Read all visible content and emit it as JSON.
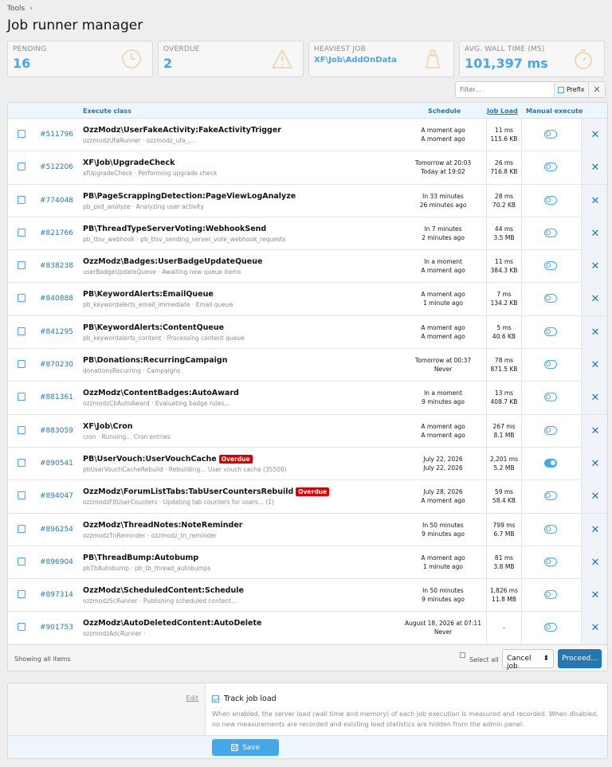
{
  "breadcrumb": {
    "tools": "Tools",
    "sep": "›"
  },
  "page_title": "Job runner manager",
  "stats": {
    "pending": {
      "label": "PENDING",
      "value": "16"
    },
    "overdue": {
      "label": "OVERDUE",
      "value": "2"
    },
    "heaviest": {
      "label": "HEAVIEST JOB",
      "value": "XF\\Job\\AddOnData"
    },
    "avgwall": {
      "label": "AVG. WALL TIME (MS)",
      "value": "101,397 ms"
    }
  },
  "filter": {
    "placeholder": "Filter...",
    "prefix": "Prefix",
    "clear": "✕"
  },
  "table": {
    "headers": {
      "execute_class": "Execute class",
      "schedule": "Schedule",
      "job_load": "Job Load",
      "manual": "Manual execute"
    },
    "rows": [
      {
        "id": "#511796",
        "cls": "OzzModz\\UserFakeActivity:FakeActivityTrigger",
        "badge": "",
        "desc": "ozzmodzUfaRunner · ozzmodz_ufa_...",
        "s1": "A moment ago",
        "s2": "A moment ago",
        "l1": "11 ms",
        "l2": "115.6 KB",
        "on": false
      },
      {
        "id": "#512206",
        "cls": "XF\\Job\\UpgradeCheck",
        "badge": "",
        "desc": "xfUpgradeCheck · Performing upgrade check",
        "s1": "Tomorrow at 20:03",
        "s2": "Today at 19:02",
        "l1": "26 ms",
        "l2": "716.8 KB",
        "on": false
      },
      {
        "id": "#774048",
        "cls": "PB\\PageScrappingDetection:PageViewLogAnalyze",
        "badge": "",
        "desc": "pb_psd_analyze · Analyzing user activity",
        "s1": "In 33 minutes",
        "s2": "26 minutes ago",
        "l1": "28 ms",
        "l2": "70.2 KB",
        "on": false
      },
      {
        "id": "#821766",
        "cls": "PB\\ThreadTypeServerVoting:WebhookSend",
        "badge": "",
        "desc": "pb_ttsv_webhook · pb_ttsv_sending_server_vote_webhook_requests",
        "s1": "In 7 minutes",
        "s2": "2 minutes ago",
        "l1": "44 ms",
        "l2": "3.5 MB",
        "on": false
      },
      {
        "id": "#838238",
        "cls": "OzzModz\\Badges:UserBadgeUpdateQueue",
        "badge": "",
        "desc": "userBadgeUpdateQueue · Awaiting new queue items",
        "s1": "In a moment",
        "s2": "A moment ago",
        "l1": "11 ms",
        "l2": "384.3 KB",
        "on": false
      },
      {
        "id": "#840888",
        "cls": "PB\\KeywordAlerts:EmailQueue",
        "badge": "",
        "desc": "pb_keywordalerts_email_immediate · Email queue",
        "s1": "A moment ago",
        "s2": "1 minute ago",
        "l1": "7 ms",
        "l2": "134.2 KB",
        "on": false
      },
      {
        "id": "#841295",
        "cls": "PB\\KeywordAlerts:ContentQueue",
        "badge": "",
        "desc": "pb_keywordalerts_content · Processing content queue",
        "s1": "A moment ago",
        "s2": "A moment ago",
        "l1": "5 ms",
        "l2": "40.6 KB",
        "on": false
      },
      {
        "id": "#870230",
        "cls": "PB\\Donations:RecurringCampaign",
        "badge": "",
        "desc": "donationsRecurring · Campaigns",
        "s1": "Tomorrow at 00:37",
        "s2": "Never",
        "l1": "78 ms",
        "l2": "871.5 KB",
        "on": false
      },
      {
        "id": "#881361",
        "cls": "OzzModz\\ContentBadges:AutoAward",
        "badge": "",
        "desc": "ozzmodzCbAutoAward · Evaluating badge rules...",
        "s1": "In a moment",
        "s2": "9 minutes ago",
        "l1": "13 ms",
        "l2": "408.7 KB",
        "on": false
      },
      {
        "id": "#883059",
        "cls": "XF\\Job\\Cron",
        "badge": "",
        "desc": "cron · Running... Cron entries",
        "s1": "A moment ago",
        "s2": "A moment ago",
        "l1": "267 ms",
        "l2": "8.1 MB",
        "on": false
      },
      {
        "id": "#890541",
        "cls": "PB\\UserVouch:UserVouchCache",
        "badge": "Overdue",
        "desc": "pbUserVouchCacheRebuild · Rebuilding... User vouch cache (35500)",
        "s1": "July 22, 2026",
        "s2": "July 22, 2026",
        "l1": "2,201 ms",
        "l2": "5.2 MB",
        "on": true
      },
      {
        "id": "#894047",
        "cls": "OzzModz\\ForumListTabs:TabUserCountersRebuild",
        "badge": "Overdue",
        "desc": "ozzmodzFltUserCounters · Updating tab counters for users... (1)",
        "s1": "July 28, 2026",
        "s2": "A moment ago",
        "l1": "59 ms",
        "l2": "58.4 KB",
        "on": false
      },
      {
        "id": "#896254",
        "cls": "OzzModz\\ThreadNotes:NoteReminder",
        "badge": "",
        "desc": "ozzmodzTnReminder · ozzmodz_tn_reminder",
        "s1": "In 50 minutes",
        "s2": "9 minutes ago",
        "l1": "799 ms",
        "l2": "6.7 MB",
        "on": false
      },
      {
        "id": "#896904",
        "cls": "PB\\ThreadBump:Autobump",
        "badge": "",
        "desc": "pbTbAutobump · pb_tb_thread_autobumps",
        "s1": "A moment ago",
        "s2": "1 minute ago",
        "l1": "81 ms",
        "l2": "3.8 MB",
        "on": false
      },
      {
        "id": "#897314",
        "cls": "OzzModz\\ScheduledContent:Schedule",
        "badge": "",
        "desc": "ozzmodzScRunner · Publishing scheduled content...",
        "s1": "In 50 minutes",
        "s2": "9 minutes ago",
        "l1": "1,826 ms",
        "l2": "11.8 MB",
        "on": false
      },
      {
        "id": "#901753",
        "cls": "OzzModz\\AutoDeletedContent:AutoDelete",
        "badge": "",
        "desc": "ozzmodzAdcRunner ·",
        "s1": "August 18, 2026 at 07:11",
        "s2": "Never",
        "l1": "-",
        "l2": "",
        "on": false
      }
    ]
  },
  "footer": {
    "showing": "Showing all items",
    "select_all": "Select all",
    "action": "Cancel job",
    "action_arrow": "⬍",
    "proceed": "Proceed..."
  },
  "options": {
    "edit": "Edit",
    "track_label": "Track job load",
    "explain": "When enabled, the server load (wall time and memory) of each job execution is measured and recorded. When disabled, no new measurements are recorded and existing load statistics are hidden from the admin panel.",
    "save": "Save"
  }
}
